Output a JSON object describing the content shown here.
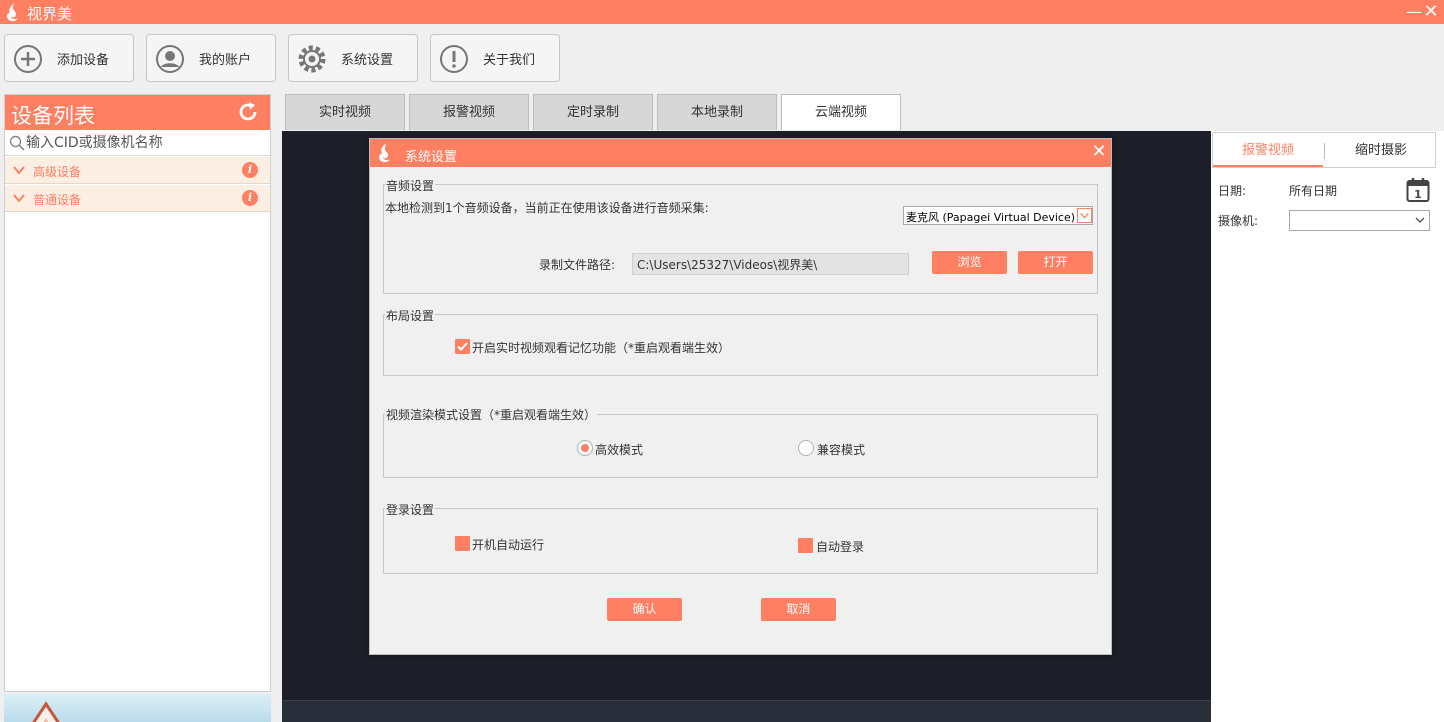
{
  "window": {
    "title": "视界美",
    "minimize_glyph": "—",
    "close_glyph": "✕"
  },
  "toolbar": {
    "add_device": "添加设备",
    "my_account": "我的账户",
    "system_settings": "系统设置",
    "about_us": "关于我们"
  },
  "sidebar": {
    "title": "设备列表",
    "search_placeholder": "输入CID或摄像机名称",
    "groups": [
      {
        "label": "高级设备",
        "info": "i"
      },
      {
        "label": "普通设备",
        "info": "i"
      }
    ]
  },
  "tabs": [
    {
      "label": "实时视频",
      "active": false
    },
    {
      "label": "报警视频",
      "active": false
    },
    {
      "label": "定时录制",
      "active": false
    },
    {
      "label": "本地录制",
      "active": false
    },
    {
      "label": "云端视频",
      "active": true
    }
  ],
  "right_panel": {
    "tab_alarm": "报警视频",
    "tab_timelapse": "缩时摄影",
    "date_label": "日期:",
    "date_value": "所有日期",
    "calendar_day": "1",
    "camera_label": "摄像机:",
    "camera_value": ""
  },
  "dialog": {
    "title": "系统设置",
    "close_glyph": "✕",
    "audio": {
      "legend": "音频设置",
      "detected_text": "本地检测到1个音频设备，当前正在使用该设备进行音频采集:",
      "device": "麦克风 (Papagei Virtual Device)",
      "path_label": "录制文件路径:",
      "path_value": "C:\\Users\\25327\\Videos\\视界美\\",
      "browse_label": "浏览",
      "open_label": "打开"
    },
    "layout": {
      "legend": "布局设置",
      "memory_label": "开启实时视频观看记忆功能（*重启观看端生效）",
      "memory_checked": true
    },
    "render": {
      "legend": "视频渲染模式设置（*重启观看端生效）",
      "efficient_label": "高效模式",
      "compatible_label": "兼容模式",
      "selected": "efficient"
    },
    "login": {
      "legend": "登录设置",
      "autorun_label": "开机自动运行",
      "autologin_label": "自动登录",
      "autorun_checked": false,
      "autologin_checked": false
    },
    "confirm_label": "确认",
    "cancel_label": "取消"
  },
  "colors": {
    "accent": "#ff7f63",
    "video_bg": "#1d1f28",
    "group_bg": "#fbeee3"
  }
}
